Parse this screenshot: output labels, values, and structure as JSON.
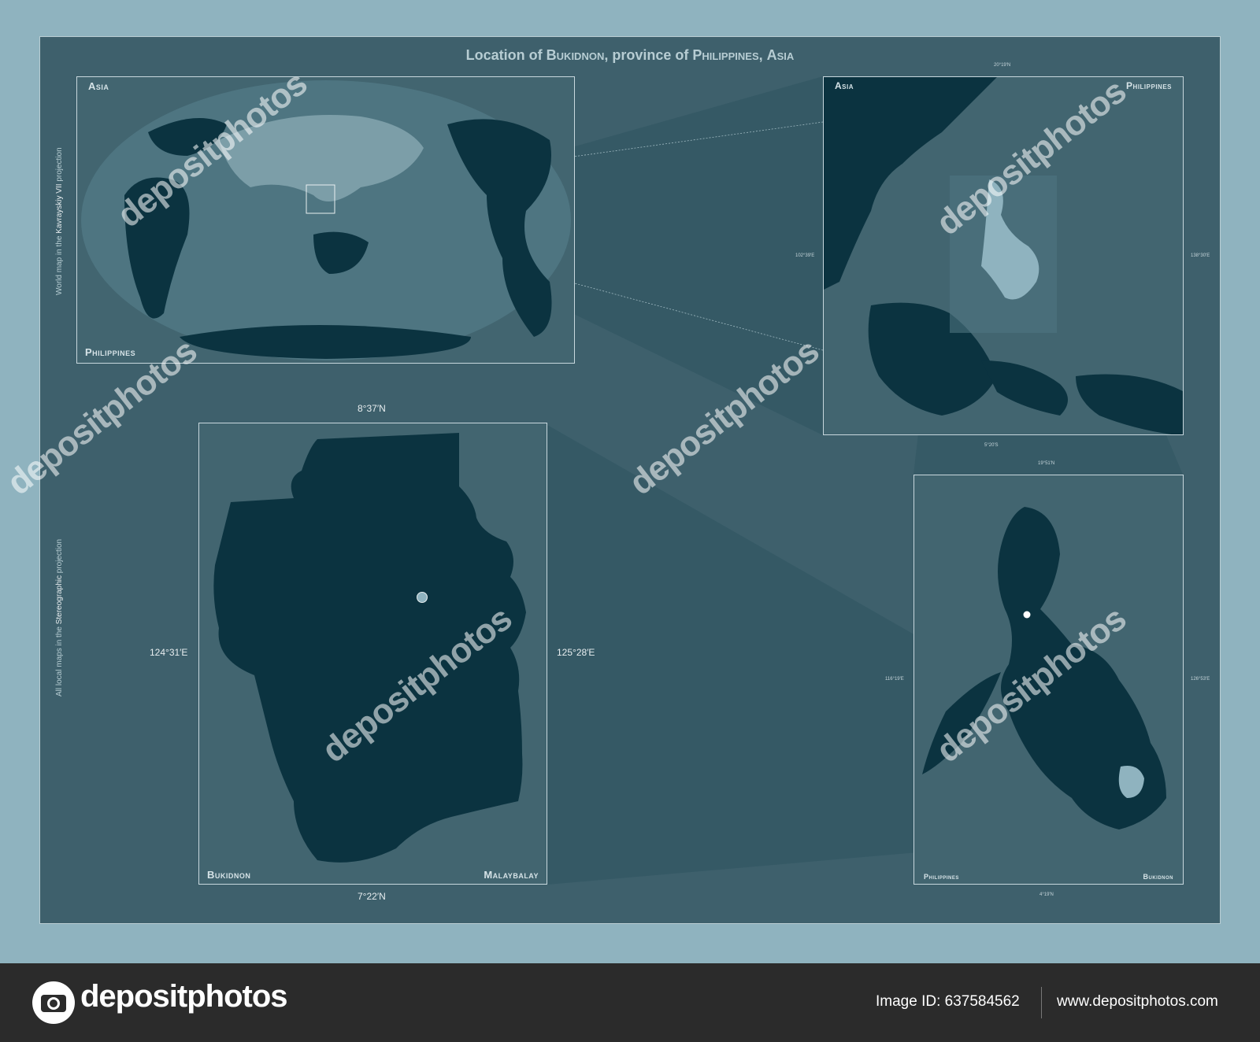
{
  "title": {
    "prefix": "Location of ",
    "province": "Bukidnon",
    "middle": ", province of ",
    "country": "Philippines",
    "separator": ", ",
    "continent": "Asia"
  },
  "side_notes": {
    "world": {
      "pre": "World map in the ",
      "name": "Kavrayskiy VII",
      "post": " projection"
    },
    "local": {
      "pre": "All local maps in the ",
      "name": "Stereographic",
      "post": " projection"
    }
  },
  "world_panel": {
    "top_left": "Asia",
    "bottom_left": "Philippines"
  },
  "region_panel": {
    "top_left": "Asia",
    "top_right": "Philippines",
    "lat_top": "20°19'N",
    "lat_bottom": "5°20'S",
    "lon_left": "102°39'E",
    "lon_right": "138°30'E"
  },
  "country_panel": {
    "bottom_left": "Philippines",
    "bottom_right": "Bukidnon",
    "lat_top": "19°51'N",
    "lat_bottom": "4°19'N",
    "lon_left": "116°19'E",
    "lon_right": "126°53'E"
  },
  "province_panel": {
    "bottom_left": "Bukidnon",
    "bottom_right": "Malaybalay",
    "lat_top": "8°37′N",
    "lat_bottom": "7°22′N",
    "lon_left": "124°31′E",
    "lon_right": "125°28′E"
  },
  "colors": {
    "background": "#8fb3bf",
    "frame": "#3e606c",
    "land": "#0b3340",
    "highlight": "#8fb3bf",
    "footer": "#2b2b2b"
  },
  "watermark": "depositphotos",
  "footer": {
    "brand": "depositphotos",
    "image_id": "Image ID: 637584562",
    "site": "www.depositphotos.com"
  }
}
